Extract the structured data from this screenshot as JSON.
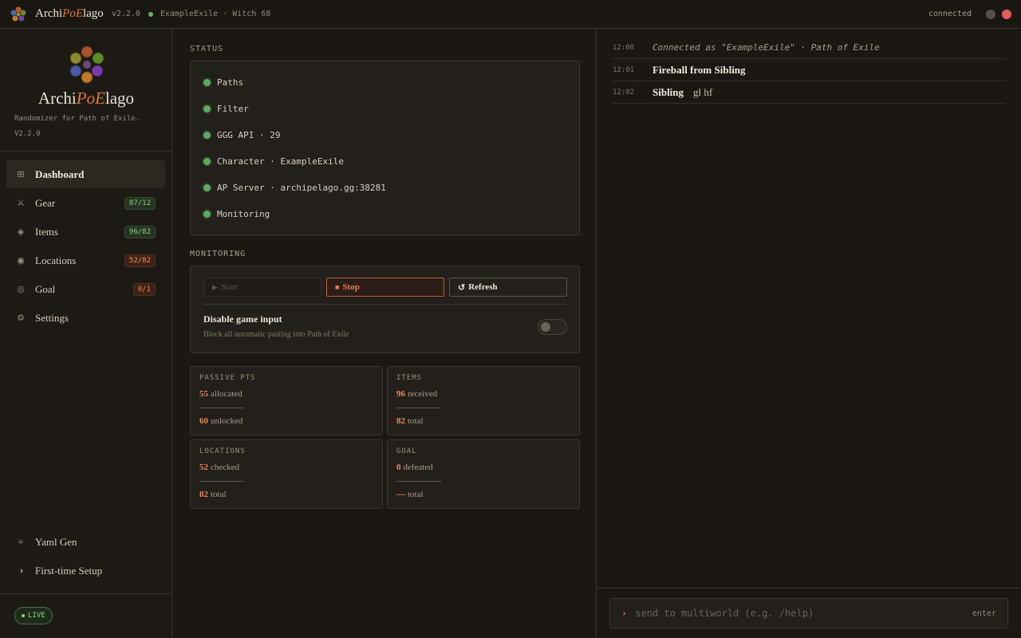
{
  "titlebar": {
    "app_name_pre": "Archi",
    "app_name_poe": "PoE",
    "app_name_post": "lago",
    "version": "v2.2.0",
    "user": "ExampleExile · Witch 68",
    "connection": "connected"
  },
  "brand": {
    "title_pre": "Archi",
    "title_poe": "PoE",
    "title_post": "lago",
    "subtitle": "Randomizer for Path of Exile. V2.2.0"
  },
  "nav": {
    "items": [
      {
        "label": "Dashboard",
        "icon": "grid-icon",
        "glyph": "⊞"
      },
      {
        "label": "Gear",
        "icon": "swords-icon",
        "glyph": "⚔",
        "badge": "87/12"
      },
      {
        "label": "Items",
        "icon": "diamond-icon",
        "glyph": "◈",
        "badge": "96/82"
      },
      {
        "label": "Locations",
        "icon": "location-icon",
        "glyph": "◉",
        "badge": "52/82"
      },
      {
        "label": "Goal",
        "icon": "target-icon",
        "glyph": "◎",
        "badge": "0/1"
      },
      {
        "label": "Settings",
        "icon": "gear-icon",
        "glyph": "⚙"
      }
    ],
    "bottom": [
      {
        "label": "Yaml Gen",
        "icon": "list-icon",
        "glyph": "≡"
      },
      {
        "label": "First-time Setup",
        "icon": "half-circle-icon",
        "glyph": "◑"
      }
    ],
    "live": "LIVE"
  },
  "status": {
    "title": "STATUS",
    "rows": [
      "Paths",
      "Filter",
      "GGG API · 29",
      "Character · ExampleExile",
      "AP Server · archipelago.gg:38281",
      "Monitoring"
    ]
  },
  "monitoring": {
    "title": "MONITORING",
    "start": "Start",
    "stop": "Stop",
    "refresh": "Refresh",
    "disable_title": "Disable game input",
    "disable_sub": "Block all automatic pasting into Path of Exile",
    "disable_on": false
  },
  "stats": {
    "passive": {
      "title": "PASSIVE PTS",
      "n1": "55",
      "l1": "allocated",
      "n2": "60",
      "l2": "unlocked"
    },
    "items": {
      "title": "ITEMS",
      "n1": "96",
      "l1": "received",
      "n2": "82",
      "l2": "total"
    },
    "locations": {
      "title": "LOCATIONS",
      "n1": "52",
      "l1": "checked",
      "n2": "82",
      "l2": "total"
    },
    "goal": {
      "title": "GOAL",
      "n1": "0",
      "l1": "defeated",
      "n2": "—",
      "l2": "total"
    }
  },
  "log": [
    {
      "time": "12:00",
      "text": "Connected as \"ExampleExile\" · Path of Exile"
    },
    {
      "time": "12:01",
      "bold": "Fireball from Sibling"
    },
    {
      "time": "12:02",
      "bold": "Sibling",
      "msg": "gl hf"
    }
  ],
  "composer": {
    "placeholder": "send to multiworld (e.g. /help)",
    "hint": "enter"
  },
  "colors": {
    "accent": "#e07b3a",
    "ok": "#5fa85f",
    "stop": "#ef7a55",
    "win_close": "#e35b5b"
  }
}
